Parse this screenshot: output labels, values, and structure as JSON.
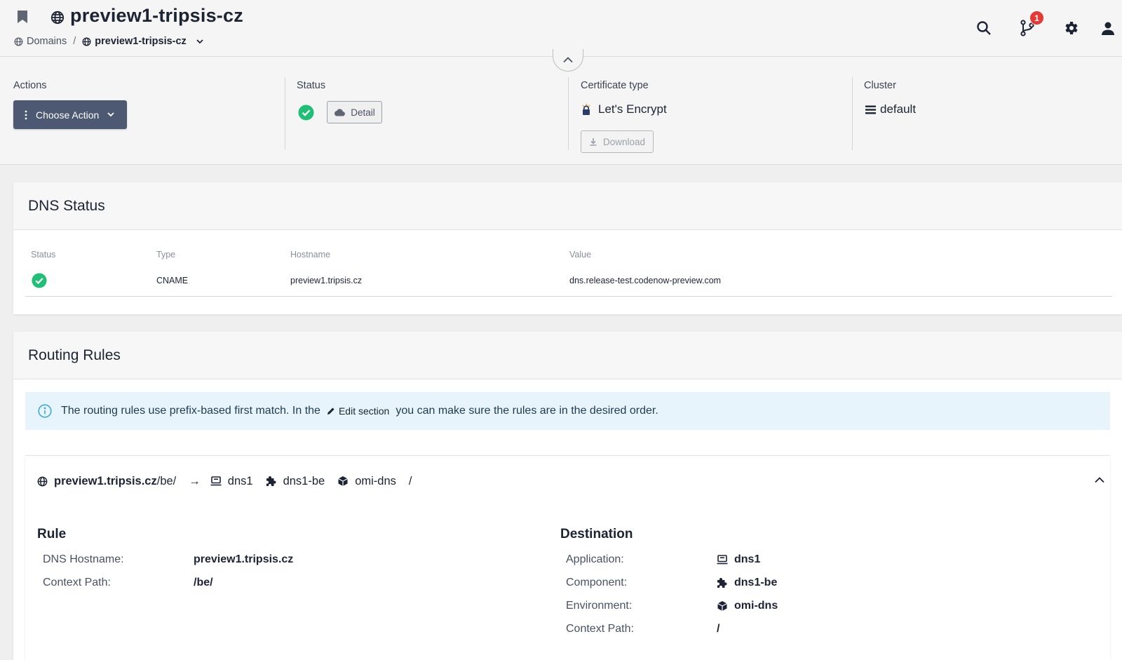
{
  "header": {
    "title": "preview1-tripsis-cz",
    "breadcrumb": {
      "root": "Domains",
      "separator": "/",
      "current": "preview1-tripsis-cz"
    },
    "notifications_count": "1",
    "icons": [
      "bookmark-icon",
      "globe-icon",
      "search-icon",
      "git-branch-icon",
      "gear-icon",
      "user-icon"
    ]
  },
  "summary": {
    "actions": {
      "label": "Actions",
      "button": "Choose Action"
    },
    "status": {
      "label": "Status",
      "detail_button": "Detail"
    },
    "certificate": {
      "label": "Certificate type",
      "value": "Let's Encrypt",
      "download_button": "Download"
    },
    "cluster": {
      "label": "Cluster",
      "value": "default"
    }
  },
  "dns_status": {
    "title": "DNS Status",
    "columns": [
      "Status",
      "Type",
      "Hostname",
      "Value"
    ],
    "rows": [
      {
        "status": "ok",
        "type": "CNAME",
        "hostname": "preview1.tripsis.cz",
        "value": "dns.release-test.codenow-preview.com"
      }
    ]
  },
  "routing_rules": {
    "title": "Routing Rules",
    "info": {
      "before": "The routing rules use prefix-based first match.  In the",
      "edit_link": "Edit section",
      "after": "you can make sure the rules are in the desired order."
    },
    "rule": {
      "summary": {
        "host": "preview1.tripsis.cz",
        "path": "/be/",
        "arrow": "→",
        "application": "dns1",
        "component": "dns1-be",
        "environment": "omi-dns",
        "context_path": "/"
      },
      "rule_section": {
        "title": "Rule",
        "dns_hostname_label": "DNS Hostname:",
        "dns_hostname": "preview1.tripsis.cz",
        "context_path_label": "Context Path:",
        "context_path": "/be/"
      },
      "destination_section": {
        "title": "Destination",
        "application_label": "Application:",
        "application": "dns1",
        "component_label": "Component:",
        "component": "dns1-be",
        "environment_label": "Environment:",
        "environment": "omi-dns",
        "context_path_label": "Context Path:",
        "context_path": "/"
      }
    }
  },
  "colors": {
    "primary_button": "#4d5972",
    "success": "#1fbf75",
    "badge": "#e53935",
    "info_bg": "#e7f4fb",
    "info_icon": "#3fa9d9"
  }
}
